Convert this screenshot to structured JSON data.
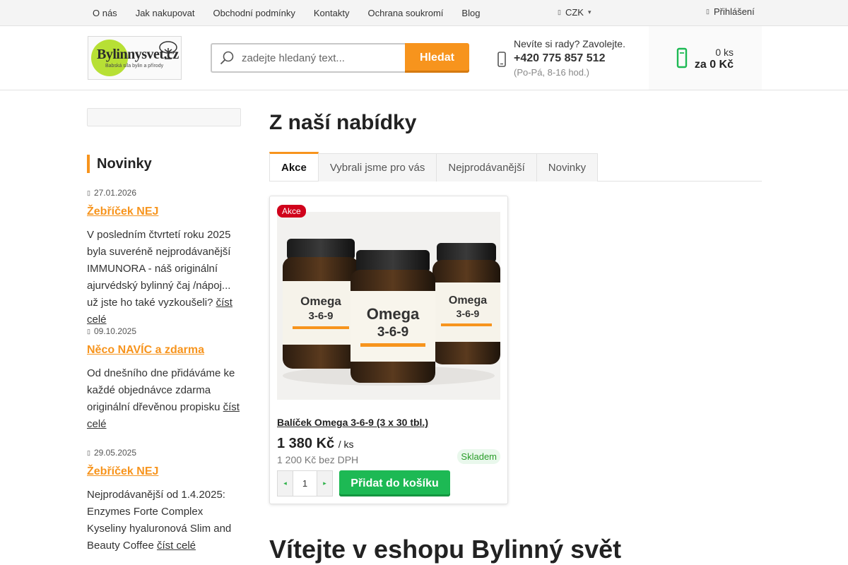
{
  "topnav": {
    "links": [
      "O nás",
      "Jak nakupovat",
      "Obchodní podmínky",
      "Kontakty",
      "Ochrana soukromí",
      "Blog"
    ],
    "currency": "CZK",
    "login": "Přihlášení"
  },
  "header": {
    "logo_text": "Bylinnysvet.cz",
    "logo_tagline": "Babská síla bylin a přírody",
    "search_placeholder": "zadejte hledaný text...",
    "search_button": "Hledat",
    "help_question": "Nevíte si rady? Zavolejte.",
    "help_phone": "+420 775 857 512",
    "help_hours": "(Po-Pá, 8-16 hod.)",
    "cart_count": "0 ks",
    "cart_total": "za 0 Kč"
  },
  "sidebar": {
    "title": "Novinky",
    "news": [
      {
        "date": "27.01.2026",
        "title": "Žebříček NEJ",
        "text": "V posledním čtvrtetí roku 2025 byla suveréně nejprodávanější IMMUNORA - náš originální ajurvédský bylinný čaj /nápoj... už jste ho také vyzkoušeli?",
        "more": "číst celé"
      },
      {
        "date": "09.10.2025",
        "title": "Něco NAVÍC a zdarma",
        "text": "Od dnešního dne přidáváme ke každé objednávce zdarma originální dřevěnou propisku",
        "more": "číst celé"
      },
      {
        "date": "29.05.2025",
        "title": "Žebříček NEJ",
        "text": "Nejprodávanější od 1.4.2025: Enzymes Forte Complex Kyseliny hyaluronová Slim and Beauty Coffee",
        "more": "číst celé"
      }
    ]
  },
  "main": {
    "title": "Z naší nabídky",
    "tabs": [
      "Akce",
      "Vybrali jsme pro vás",
      "Nejprodávanější",
      "Novinky"
    ],
    "active_tab": "Akce",
    "product": {
      "badge": "Akce",
      "name": "Balíček Omega 3-6-9 (3 x 30 tbl.)",
      "price": "1 380 Kč",
      "unit": "/ ks",
      "price_net": "1 200 Kč bez DPH",
      "stock": "Skladem",
      "quantity": "1",
      "add_button": "Přidat do košíku",
      "jar_label": "Omega",
      "jar_sub": "3-6-9"
    },
    "welcome": "Vítejte v eshopu Bylinný svět"
  },
  "colors": {
    "accent": "#f7941d",
    "green": "#1db954",
    "badge": "#d0021b"
  },
  "icons": [
    "user-icon",
    "chevron-down-icon",
    "search-icon",
    "phone-icon",
    "cart-icon",
    "calendar-icon",
    "minus-icon",
    "plus-icon"
  ]
}
